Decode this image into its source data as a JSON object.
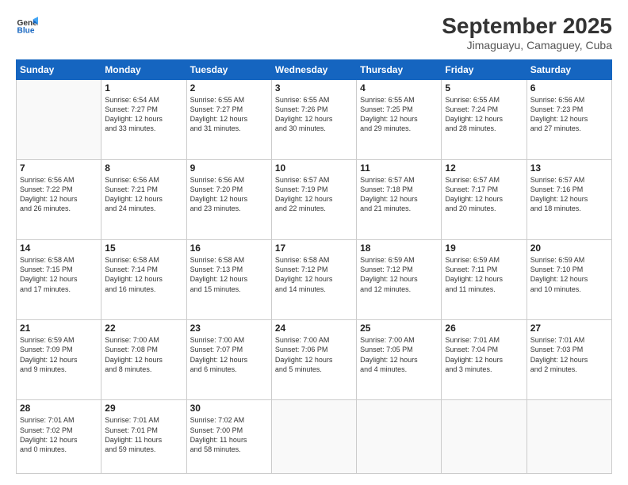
{
  "header": {
    "logo_line1": "General",
    "logo_line2": "Blue",
    "title": "September 2025",
    "subtitle": "Jimaguayu, Camaguey, Cuba"
  },
  "weekdays": [
    "Sunday",
    "Monday",
    "Tuesday",
    "Wednesday",
    "Thursday",
    "Friday",
    "Saturday"
  ],
  "weeks": [
    [
      {
        "day": "",
        "info": ""
      },
      {
        "day": "1",
        "info": "Sunrise: 6:54 AM\nSunset: 7:27 PM\nDaylight: 12 hours\nand 33 minutes."
      },
      {
        "day": "2",
        "info": "Sunrise: 6:55 AM\nSunset: 7:27 PM\nDaylight: 12 hours\nand 31 minutes."
      },
      {
        "day": "3",
        "info": "Sunrise: 6:55 AM\nSunset: 7:26 PM\nDaylight: 12 hours\nand 30 minutes."
      },
      {
        "day": "4",
        "info": "Sunrise: 6:55 AM\nSunset: 7:25 PM\nDaylight: 12 hours\nand 29 minutes."
      },
      {
        "day": "5",
        "info": "Sunrise: 6:55 AM\nSunset: 7:24 PM\nDaylight: 12 hours\nand 28 minutes."
      },
      {
        "day": "6",
        "info": "Sunrise: 6:56 AM\nSunset: 7:23 PM\nDaylight: 12 hours\nand 27 minutes."
      }
    ],
    [
      {
        "day": "7",
        "info": "Sunrise: 6:56 AM\nSunset: 7:22 PM\nDaylight: 12 hours\nand 26 minutes."
      },
      {
        "day": "8",
        "info": "Sunrise: 6:56 AM\nSunset: 7:21 PM\nDaylight: 12 hours\nand 24 minutes."
      },
      {
        "day": "9",
        "info": "Sunrise: 6:56 AM\nSunset: 7:20 PM\nDaylight: 12 hours\nand 23 minutes."
      },
      {
        "day": "10",
        "info": "Sunrise: 6:57 AM\nSunset: 7:19 PM\nDaylight: 12 hours\nand 22 minutes."
      },
      {
        "day": "11",
        "info": "Sunrise: 6:57 AM\nSunset: 7:18 PM\nDaylight: 12 hours\nand 21 minutes."
      },
      {
        "day": "12",
        "info": "Sunrise: 6:57 AM\nSunset: 7:17 PM\nDaylight: 12 hours\nand 20 minutes."
      },
      {
        "day": "13",
        "info": "Sunrise: 6:57 AM\nSunset: 7:16 PM\nDaylight: 12 hours\nand 18 minutes."
      }
    ],
    [
      {
        "day": "14",
        "info": "Sunrise: 6:58 AM\nSunset: 7:15 PM\nDaylight: 12 hours\nand 17 minutes."
      },
      {
        "day": "15",
        "info": "Sunrise: 6:58 AM\nSunset: 7:14 PM\nDaylight: 12 hours\nand 16 minutes."
      },
      {
        "day": "16",
        "info": "Sunrise: 6:58 AM\nSunset: 7:13 PM\nDaylight: 12 hours\nand 15 minutes."
      },
      {
        "day": "17",
        "info": "Sunrise: 6:58 AM\nSunset: 7:12 PM\nDaylight: 12 hours\nand 14 minutes."
      },
      {
        "day": "18",
        "info": "Sunrise: 6:59 AM\nSunset: 7:12 PM\nDaylight: 12 hours\nand 12 minutes."
      },
      {
        "day": "19",
        "info": "Sunrise: 6:59 AM\nSunset: 7:11 PM\nDaylight: 12 hours\nand 11 minutes."
      },
      {
        "day": "20",
        "info": "Sunrise: 6:59 AM\nSunset: 7:10 PM\nDaylight: 12 hours\nand 10 minutes."
      }
    ],
    [
      {
        "day": "21",
        "info": "Sunrise: 6:59 AM\nSunset: 7:09 PM\nDaylight: 12 hours\nand 9 minutes."
      },
      {
        "day": "22",
        "info": "Sunrise: 7:00 AM\nSunset: 7:08 PM\nDaylight: 12 hours\nand 8 minutes."
      },
      {
        "day": "23",
        "info": "Sunrise: 7:00 AM\nSunset: 7:07 PM\nDaylight: 12 hours\nand 6 minutes."
      },
      {
        "day": "24",
        "info": "Sunrise: 7:00 AM\nSunset: 7:06 PM\nDaylight: 12 hours\nand 5 minutes."
      },
      {
        "day": "25",
        "info": "Sunrise: 7:00 AM\nSunset: 7:05 PM\nDaylight: 12 hours\nand 4 minutes."
      },
      {
        "day": "26",
        "info": "Sunrise: 7:01 AM\nSunset: 7:04 PM\nDaylight: 12 hours\nand 3 minutes."
      },
      {
        "day": "27",
        "info": "Sunrise: 7:01 AM\nSunset: 7:03 PM\nDaylight: 12 hours\nand 2 minutes."
      }
    ],
    [
      {
        "day": "28",
        "info": "Sunrise: 7:01 AM\nSunset: 7:02 PM\nDaylight: 12 hours\nand 0 minutes."
      },
      {
        "day": "29",
        "info": "Sunrise: 7:01 AM\nSunset: 7:01 PM\nDaylight: 11 hours\nand 59 minutes."
      },
      {
        "day": "30",
        "info": "Sunrise: 7:02 AM\nSunset: 7:00 PM\nDaylight: 11 hours\nand 58 minutes."
      },
      {
        "day": "",
        "info": ""
      },
      {
        "day": "",
        "info": ""
      },
      {
        "day": "",
        "info": ""
      },
      {
        "day": "",
        "info": ""
      }
    ]
  ]
}
